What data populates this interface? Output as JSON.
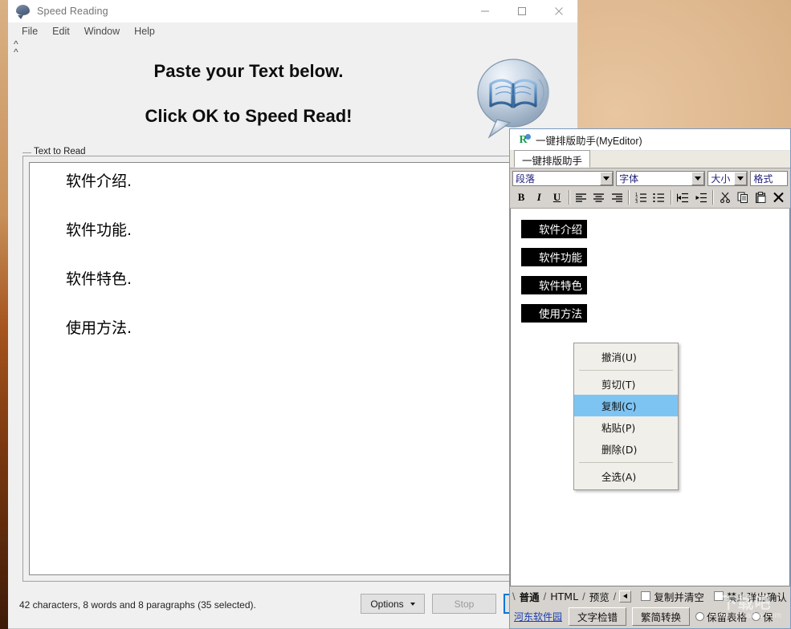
{
  "desktop": {
    "watermark_cn": "下载吧",
    "watermark_url": "www.xiazaiba.com"
  },
  "speed_reading": {
    "title": "Speed Reading",
    "title_icon": "speech-bubble-icon",
    "window_controls": {
      "minimize": "minimize-icon",
      "maximize": "maximize-icon",
      "close": "close-icon"
    },
    "menu": [
      "File",
      "Edit",
      "Window",
      "Help"
    ],
    "collapse_icon": "double-chevron-up-icon",
    "heading_1": "Paste your Text below.",
    "heading_2": "Click OK to Speed Read!",
    "logo_icon": "book-in-speech-bubble-logo",
    "group_label": "Text to Read",
    "text_lines": [
      "软件介绍.",
      "软件功能.",
      "软件特色.",
      "使用方法."
    ],
    "status_text": "42 characters, 8 words and 8 paragraphs (35 selected).",
    "buttons": {
      "options": "Options",
      "stop": "Stop",
      "ok": ""
    }
  },
  "editor": {
    "title": "一键排版助手(MyEditor)",
    "logo_icon": "r-logo-icon",
    "tab": "一键排版助手",
    "toolbar": {
      "combo_paragraph": "段落",
      "combo_font": "字体",
      "combo_size": "大小",
      "combo_format": "格式",
      "bold": "B",
      "italic": "I",
      "underline": "U",
      "align_left": "align-left-icon",
      "align_center": "align-center-icon",
      "align_right": "align-right-icon",
      "ordered_list": "ordered-list-icon",
      "unordered_list": "unordered-list-icon",
      "outdent": "outdent-icon",
      "indent": "indent-icon",
      "cut": "scissors-icon",
      "copy": "copy-icon",
      "paste": "clipboard-paste-icon",
      "delete": "x-delete-icon"
    },
    "content_lines": [
      "软件介绍",
      "软件功能",
      "软件特色",
      "使用方法"
    ],
    "context_menu": [
      {
        "label": "撤消(U)",
        "selected": false
      },
      {
        "label": "剪切(T)",
        "selected": false
      },
      {
        "label": "复制(C)",
        "selected": true
      },
      {
        "label": "粘贴(P)",
        "selected": false
      },
      {
        "label": "删除(D)",
        "selected": false
      },
      {
        "label": "全选(A)",
        "selected": false
      }
    ],
    "sheet_tabs": [
      {
        "label": "普通",
        "active": true
      },
      {
        "label": "HTML",
        "active": false
      },
      {
        "label": "预览",
        "active": false
      }
    ],
    "checkboxes": [
      {
        "label": "复制并清空",
        "checked": false
      },
      {
        "label": "禁止弹出确认",
        "checked": false
      }
    ],
    "link": "河东软件园",
    "action_buttons": [
      "文字检错",
      "繁简转换"
    ],
    "radios": [
      {
        "label": "保留表格",
        "checked": false
      },
      {
        "label": "保",
        "checked": false
      }
    ]
  },
  "colors": {
    "accent_blue": "#0078d7",
    "selection_blue": "#7ec4f2",
    "desktop_tan": "#dbb389",
    "toolbar_gray": "#d6d3ce"
  }
}
